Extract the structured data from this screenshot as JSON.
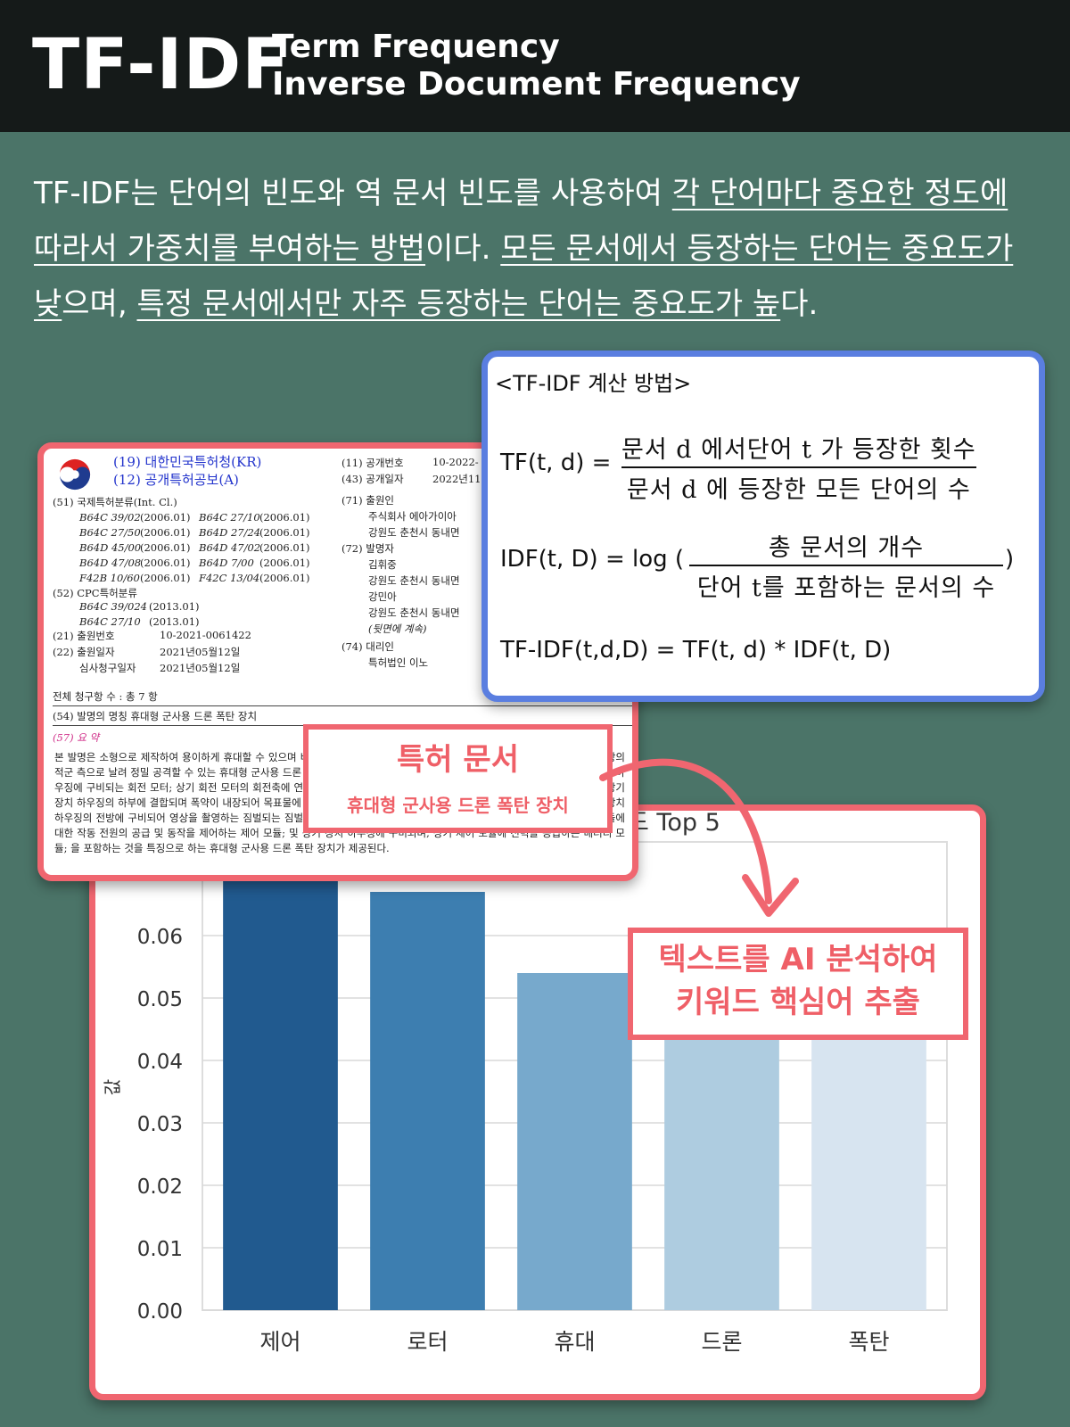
{
  "header": {
    "title": "TF-IDF",
    "subtitle_line1": "Term Frequency",
    "subtitle_line2": "Inverse Document Frequency"
  },
  "intro": {
    "p1": "TF-IDF는 단어의 빈도와 역 문서 빈도를 사용하여 ",
    "u1": "각 단어마다 중요한 정도에 따라서 가중치를 부여하는 방법",
    "p2": "이다. ",
    "u2": "모든 문서에서 등장하는 단어는 중요도가 낮",
    "p3": "으며, ",
    "u3": "특정 문서에서만 자주 등장하는 단어는 중요도가 높",
    "p4": "다."
  },
  "formula": {
    "heading": "<TF-IDF 계산 방법>",
    "tf_lhs": "TF(t, d) =",
    "tf_num": "문서 d 에서단어 t 가 등장한 횟수",
    "tf_den": "문서 d 에 등장한 모든 단어의 수",
    "idf_lhs": "IDF(t, D) = log (",
    "idf_num": "총 문서의 개수",
    "idf_den": "단어 t를 포함하는 문서의 수",
    "idf_close": ")",
    "tfidf": "TF-IDF(t,d,D) = TF(t, d) * IDF(t, D)"
  },
  "patent": {
    "office": "(19) 대한민국특허청(KR)",
    "pubtype": "(12) 공개특허공보(A)",
    "pubno_label": "(11) 공개번호",
    "pubno": "10-2022-",
    "pubdate_label": "(43) 공개일자",
    "pubdate": "2022년11",
    "ipc_label": "(51) 국제특허분류(Int. Cl.)",
    "ipc": [
      [
        "B64C 39/02",
        "(2006.01)",
        "B64C 27/10",
        "(2006.01)"
      ],
      [
        "B64C 27/50",
        "(2006.01)",
        "B64D 27/24",
        "(2006.01)"
      ],
      [
        "B64D 45/00",
        "(2006.01)",
        "B64D 47/02",
        "(2006.01)"
      ],
      [
        "B64D 47/08",
        "(2006.01)",
        "B64D 7/00",
        "(2006.01)"
      ],
      [
        "F42B 10/60",
        "(2006.01)",
        "F42C 13/04",
        "(2006.01)"
      ]
    ],
    "cpc_label": "(52) CPC특허분류",
    "cpc": [
      [
        "B64C 39/024",
        "(2013.01)"
      ],
      [
        "B64C 27/10",
        "(2013.01)"
      ]
    ],
    "appno_label": "(21) 출원번호",
    "appno": "10-2021-0061422",
    "appdate_label": "(22) 출원일자",
    "appdate": "2021년05월12일",
    "exam_label": "심사청구일자",
    "exam_date": "2021년05월12일",
    "applicant_label": "(71) 출원인",
    "applicant_name": "주식회사 에아가이아",
    "applicant_addr": "강원도 춘천시 동내면",
    "inventor_label": "(72) 발명자",
    "inventor1": "김휘중",
    "inventor1_addr": "강원도 춘천시 동내면",
    "inventor2": "강민아",
    "inventor2_addr": "강원도 춘천시 동내면",
    "continued": "(뒷면에 계속)",
    "agent_label": "(74) 대리인",
    "agent": "특허법인 이노",
    "claims": "전체 청구항 수 : 총 7 항",
    "invention_title": "(54) 발명의 명칭 휴대형 군사용 드론 폭탄 장치",
    "abstract_title": "(57) 요 약",
    "abstract": "본 발명은 소형으로 제작하여 용이하게 휴대할 수 있으며 비행이 가능한 드론에 폭탄을 장착하여 원격으로 조종하되 일정 거리 이상의 적군 측으로 날려 정밀 공격할 수 있는 휴대형 군사용 드론 폭탄 장치에 관한 것으로, 보다 구체적으로는 면, 장치 하우징; 상기 장치 하우징에 구비되는 회전 모터; 상기 회전 모터의 회전축에 연결되어 회전하는 프로펠러; 상기 전축에 연결되어 구비되는 로터 모듈; 상기 장치 하우징의 하부에 결합되며 폭약이 내장되어 목표물에 충돌하여 여 폭발하는 신관 어셈블리 모듈을 포함하는 살상 모듈; 상기 장치 하우징의 전방에 구비되어 영상을 촬영하는 짐벌되는 짐벌 카메라 모듈; 상기 회전 모터와 신관 어셈블리 모듈 및 짐벌 카메라 모듈에 대한 작동 전원의 공급 및 동작을 제어하는 제어 모듈; 및 상기 장치 하우징에 구비되며, 상기 제어 모듈에 전력을 공급하는 배터리 모듈; 을 포함하는 것을 특징으로 하는 휴대형 군사용 드론 폭탄 장치가 제공된다."
  },
  "labels": {
    "patent_main": "특허 문서",
    "patent_sub": "휴대형 군사용 드론 폭탄 장치",
    "ai_line1": "텍스트를 AI 분석하여",
    "ai_line2": "키워드 핵심어 추출"
  },
  "chart_data": {
    "type": "bar",
    "title": "드 Top 5",
    "ylabel": "값",
    "categories": [
      "제어",
      "로터",
      "휴대",
      "드론",
      "폭탄"
    ],
    "values": [
      0.071,
      0.067,
      0.054,
      0.05,
      0.048
    ],
    "colors": [
      "#215a8f",
      "#3d7eb0",
      "#77a9cc",
      "#aecce0",
      "#d7e4f0"
    ],
    "ylim": [
      0.0,
      0.075
    ],
    "yticks": [
      "0.00",
      "0.01",
      "0.02",
      "0.03",
      "0.04",
      "0.05",
      "0.06"
    ],
    "grid": true
  }
}
